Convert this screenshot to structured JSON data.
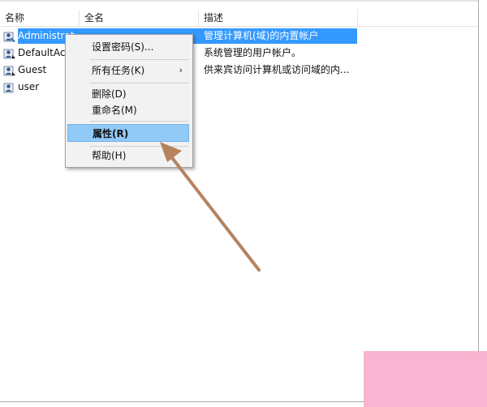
{
  "columns": {
    "name": "名称",
    "fullname": "全名",
    "description": "描述"
  },
  "users": [
    {
      "name": "Administrat",
      "fullname": "",
      "description": "管理计算机(域)的内置帐户",
      "selected": true
    },
    {
      "name": "DefaultAcc",
      "fullname": "",
      "description": "系统管理的用户帐户。"
    },
    {
      "name": "Guest",
      "fullname": "",
      "description": "供来宾访问计算机或访问域的内..."
    },
    {
      "name": "user",
      "fullname": "",
      "description": ""
    }
  ],
  "context_menu": {
    "set_password": "设置密码(S)...",
    "all_tasks": "所有任务(K)",
    "all_tasks_arrow": "›",
    "delete": "删除(D)",
    "rename": "重命名(M)",
    "properties": "属性(R)",
    "help": "帮助(H)"
  },
  "colors": {
    "selection": "#3399ff",
    "menu_highlight": "#91c9f7",
    "annotation_arrow": "#b5835f",
    "corner_block": "#f8b4d0"
  },
  "icons": {
    "user": "user-account-icon"
  }
}
